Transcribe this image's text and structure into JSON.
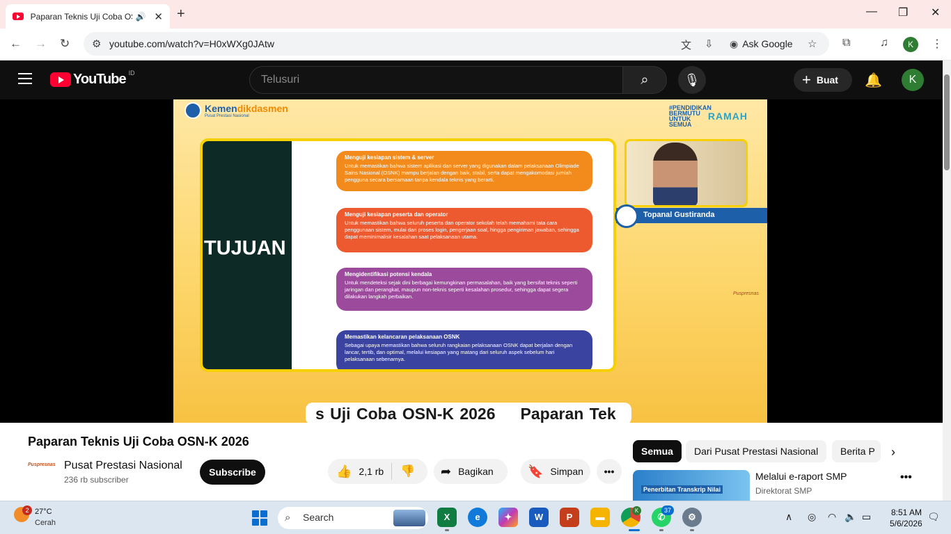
{
  "browser": {
    "tab_title": "Paparan Teknis Uji Coba OSN",
    "url": "youtube.com/watch?v=H0xWXg0JAtw",
    "ask_google": "Ask Google",
    "profile_initial": "K"
  },
  "youtube": {
    "logo_text": "YouTube",
    "country": "ID",
    "search_placeholder": "Telusuri",
    "create_label": "Buat",
    "avatar_initial": "K"
  },
  "video": {
    "brand_a": "Kemen",
    "brand_b": "dikdasmen",
    "brand_sub": "Pusat Prestasi Nasional",
    "hashtag": "#PENDIDIKAN BERMUTU UNTUK SEMUA",
    "ramah": "RAMAH",
    "slide_heading": "TUJUAN",
    "cards": [
      {
        "title": "Menguji kesiapan sistem & server",
        "body": "Untuk memastikan bahwa sistem aplikasi dan server yang digunakan dalam pelaksanaan Olimpiade Sains Nasional (OSNK) mampu berjalan dengan baik, stabil, serta dapat mengakomodasi jumlah pengguna secara bersamaan tanpa kendala teknis yang berarti.",
        "color": "#f28a1c"
      },
      {
        "title": "Menguji kesiapan peserta dan operator",
        "body": "Untuk memastikan bahwa seluruh peserta dan operator sekolah telah memahami tata cara penggunaan sistem, mulai dari proses login, pengerjaan soal, hingga pengiriman jawaban, sehingga dapat meminimalisir kesalahan saat pelaksanaan utama.",
        "color": "#ee5a2f"
      },
      {
        "title": "Mengidentifikasi potensi kendala",
        "body": "Untuk mendeteksi sejak dini berbagai kemungkinan permasalahan, baik yang bersifat teknis seperti jaringan dan perangkat, maupun non-teknis seperti kesalahan prosedur, sehingga dapat segera dilakukan langkah perbaikan.",
        "color": "#9b4a9c"
      },
      {
        "title": "Memastikan kelancaran pelaksanaan OSNK",
        "body": "Sebagai upaya memastikan bahwa seluruh rangkaian pelaksanaan OSNK dapat berjalan dengan lancar, tertib, dan optimal, melalui kesiapan yang matang dari seluruh aspek sebelum hari pelaksanaan sebenarnya.",
        "color": "#3b43a0"
      }
    ],
    "speaker_name": "Topanal Gustiranda",
    "ticker_a": "s Uji Coba OSN-K 2026",
    "ticker_b": "Paparan Tek",
    "watermark": "Puspresnas"
  },
  "info": {
    "title": "Paparan Teknis Uji Coba OSN-K 2026",
    "channel": "Pusat Prestasi Nasional",
    "channel_logo": "Puspresnas",
    "subscribers": "236 rb subscriber",
    "subscribe_label": "Subscribe",
    "likes": "2,1 rb",
    "share_label": "Bagikan",
    "save_label": "Simpan",
    "more": "•••"
  },
  "sidebar": {
    "chips": [
      "Semua",
      "Dari Pusat Prestasi Nasional",
      "Berita P"
    ],
    "related": {
      "title": "Melalui e-raport SMP",
      "channel": "Direktorat SMP",
      "thumb_text": "Penerbitan Transkrip Nilai"
    }
  },
  "taskbar": {
    "weather_badge": "2",
    "temp": "27°C",
    "condition": "Cerah",
    "search": "Search",
    "chrome_badge": "K",
    "whatsapp_badge": "37",
    "time": "8:51 AM",
    "date": "5/6/2026"
  }
}
